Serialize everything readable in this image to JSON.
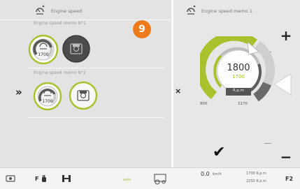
{
  "left": {
    "title": "Engine speed",
    "memo1_label": "Engine speed memo N°1",
    "memo2_label": "Engine speed memo N°2",
    "knob1_value": "1700",
    "knob2_value": "1700",
    "badge_number": "9"
  },
  "right": {
    "title": "Engine speed memo 1",
    "gauge_value": "1800",
    "gauge_set_value": "1700",
    "gauge_unit": "R.p.m",
    "gauge_min": "800",
    "gauge_max": "2270",
    "plus_label": "+",
    "minus_label": "−",
    "confirm_label": "✔",
    "cancel_label": "×"
  },
  "bottom": {
    "f_left": "F",
    "speed_value": "0.0",
    "speed_unit": "km/h",
    "rpm_line1": "1700 R.p.m",
    "rpm_line2": "2250 R.p.m",
    "f2_label": "F2",
    "mode_label": "auto"
  },
  "colors": {
    "accent_green": "#a9c12d",
    "badge_orange": "#ee7a1c",
    "dark_gray": "#4c4c4c"
  }
}
